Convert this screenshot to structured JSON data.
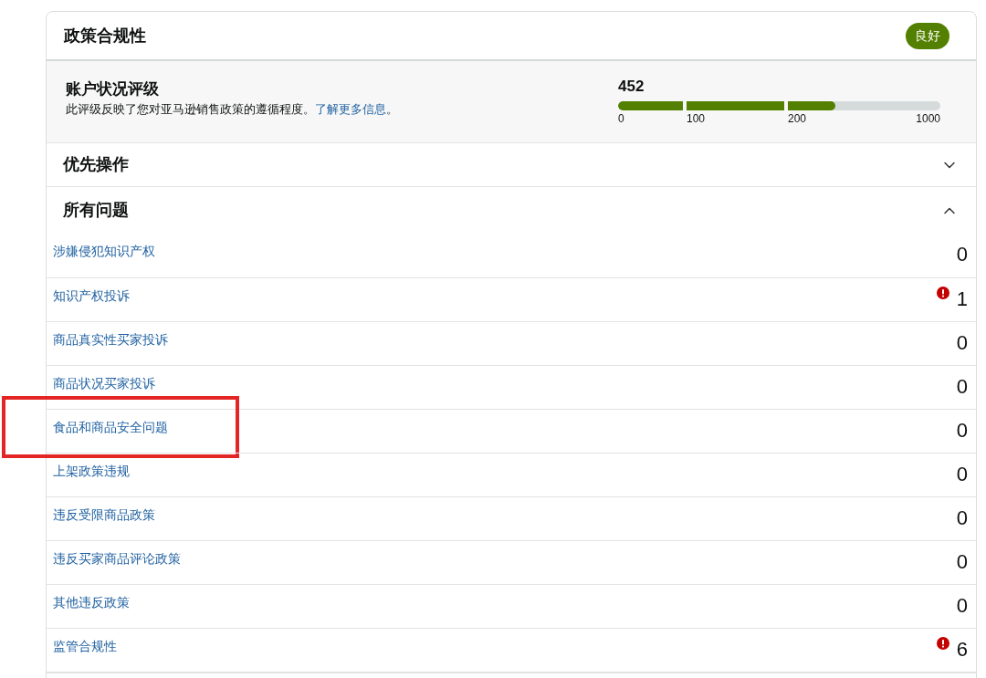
{
  "card": {
    "title": "政策合规性",
    "status": {
      "label": "良好"
    }
  },
  "rating": {
    "title": "账户状况评级",
    "description": {
      "before": "此评级反映了您对亚马逊销售政策的遵循程度。",
      "link": "了解更多信息",
      "after": "。"
    },
    "score": "452",
    "scale": {
      "segments": [
        {
          "start_label": "0",
          "level": 1
        },
        {
          "start_label": "100",
          "level": 1
        },
        {
          "start_label": "200",
          "level": 0.31
        }
      ],
      "end_label": "1000"
    }
  },
  "sections": [
    {
      "title": "优先操作",
      "expanded": false
    },
    {
      "title": "所有问题",
      "expanded": true,
      "items": [
        {
          "label": "涉嫌侵犯知识产权",
          "count": "0",
          "alert": false,
          "highlighted": false
        },
        {
          "label": "知识产权投诉",
          "count": "1",
          "alert": true,
          "highlighted": false
        },
        {
          "label": "商品真实性买家投诉",
          "count": "0",
          "alert": false,
          "highlighted": false
        },
        {
          "label": "商品状况买家投诉",
          "count": "0",
          "alert": false,
          "highlighted": false
        },
        {
          "label": "食品和商品安全问题",
          "count": "0",
          "alert": false,
          "highlighted": true
        },
        {
          "label": "上架政策违规",
          "count": "0",
          "alert": false,
          "highlighted": false
        },
        {
          "label": "违反受限商品政策",
          "count": "0",
          "alert": false,
          "highlighted": false
        },
        {
          "label": "违反买家商品评论政策",
          "count": "0",
          "alert": false,
          "highlighted": false
        },
        {
          "label": "其他违反政策",
          "count": "0",
          "alert": false,
          "highlighted": false
        },
        {
          "label": "监管合规性",
          "count": "6",
          "alert": true,
          "highlighted": false
        }
      ]
    }
  ]
}
